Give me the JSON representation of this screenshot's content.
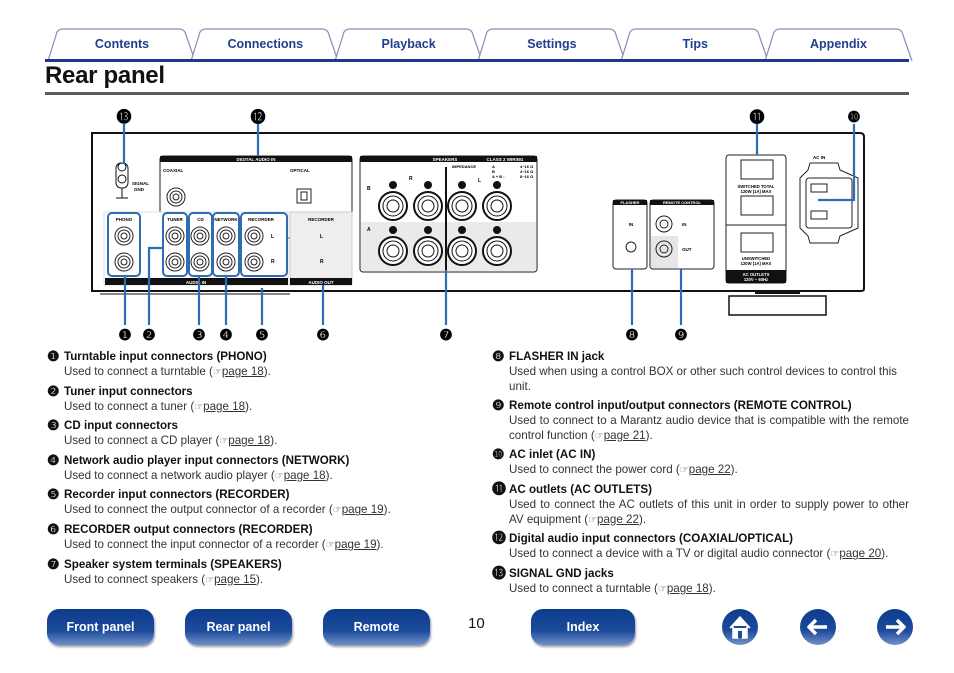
{
  "tabs": [
    {
      "label": "Contents"
    },
    {
      "label": "Connections"
    },
    {
      "label": "Playback"
    },
    {
      "label": "Settings"
    },
    {
      "label": "Tips"
    },
    {
      "label": "Appendix"
    }
  ],
  "page_title": "Rear panel",
  "diagram": {
    "digital_audio_in": "DIGITAL AUDIO IN",
    "coaxial": "COAXIAL",
    "optical": "OPTICAL",
    "signal_gnd": "SIGNAL",
    "gnd": "GND",
    "phono": "PHONO",
    "tuner": "TUNER",
    "cd": "CD",
    "network": "NETWORK",
    "recorder": "RECORDER",
    "recorder_out": "RECORDER",
    "audio_in": "AUDIO IN",
    "audio_out": "AUDIO OUT",
    "L": "L",
    "R": "R",
    "speakers": "SPEAKERS",
    "class2": "CLASS 2 WIRING",
    "impedance": "IMPEDANCE",
    "imp_a": "A",
    "imp_b": "B",
    "imp_ab": "A + B :",
    "imp_a_val": "4~16 Ω",
    "imp_b_val": "4~16 Ω",
    "imp_ab_val": "8~16 Ω",
    "spk_A": "A",
    "spk_B": "B",
    "spk_R": "R",
    "spk_L": "L",
    "flasher": "FLASHER",
    "in": "IN",
    "remote_control": "REMOTE CONTROL",
    "out": "OUT",
    "switched": "SWITCHED TOTAL",
    "switched_rating": "120W (1A) MAX",
    "unswitched": "UNSWITCHED",
    "unswitched_rating": "120W (1A) MAX",
    "ac_outlets": "AC OUTLETS",
    "ac_outlets_rating": "120V ~ 60Hz",
    "ac_in": "AC IN",
    "callouts": [
      "❶",
      "❷",
      "❸",
      "❹",
      "❺",
      "❻",
      "❼",
      "❽",
      "❾",
      "❿",
      "⓫",
      "⓬",
      "⓭"
    ]
  },
  "items_left": [
    {
      "num": "❶",
      "title": "Turntable input connectors (PHONO)",
      "desc": "Used to connect a turntable (",
      "page": "page 18",
      "after": ")."
    },
    {
      "num": "❷",
      "title": "Tuner input connectors",
      "desc": "Used to connect a tuner (",
      "page": "page 18",
      "after": ")."
    },
    {
      "num": "❸",
      "title": "CD input connectors",
      "desc": "Used to connect a CD player (",
      "page": "page 18",
      "after": ")."
    },
    {
      "num": "❹",
      "title": "Network audio player input connectors (NETWORK)",
      "desc": "Used to connect a network audio player (",
      "page": "page 18",
      "after": ")."
    },
    {
      "num": "❺",
      "title": "Recorder input connectors (RECORDER)",
      "desc": "Used to connect the output connector of a recorder (",
      "page": "page 19",
      "after": ")."
    },
    {
      "num": "❻",
      "title": "RECORDER output connectors (RECORDER)",
      "desc": "Used to connect the input connector of a recorder (",
      "page": "page 19",
      "after": ")."
    },
    {
      "num": "❼",
      "title": "Speaker system terminals (SPEAKERS)",
      "desc": "Used to connect speakers (",
      "page": "page 15",
      "after": ")."
    }
  ],
  "items_right": [
    {
      "num": "❽",
      "title": "FLASHER IN jack",
      "desc": "Used when using a control BOX or other such control devices to control this unit."
    },
    {
      "num": "❾",
      "title": "Remote control input/output connectors (REMOTE CONTROL)",
      "desc": "Used to connect to a Marantz audio device that is compatible with the remote control function (",
      "page": "page 21",
      "after": ")."
    },
    {
      "num": "❿",
      "title": "AC inlet (AC IN)",
      "desc": "Used to connect the power cord (",
      "page": "page 22",
      "after": ")."
    },
    {
      "num": "⓫",
      "title": "AC outlets (AC OUTLETS)",
      "desc": "Used to connect the AC outlets of this unit in order to supply power to other AV equipment (",
      "page": "page 22",
      "after": ")."
    },
    {
      "num": "⓬",
      "title": "Digital audio input connectors (COAXIAL/OPTICAL)",
      "desc": "Used to connect a device with a TV or digital audio connector (",
      "page": "page 20",
      "after": ")."
    },
    {
      "num": "⓭",
      "title": "SIGNAL GND jacks",
      "desc": "Used to connect a turntable (",
      "page": "page 18",
      "after": ")."
    }
  ],
  "ref_icon": "☞",
  "footer": {
    "front_panel": "Front panel",
    "rear_panel": "Rear panel",
    "remote": "Remote",
    "page_number": "10",
    "index": "Index",
    "home_icon": "home-icon",
    "back_icon": "arrow-left-icon",
    "forward_icon": "arrow-right-icon"
  },
  "colors": {
    "accent": "#1b3a86",
    "callout": "#2e6db4",
    "button": "#1c4b9c"
  }
}
